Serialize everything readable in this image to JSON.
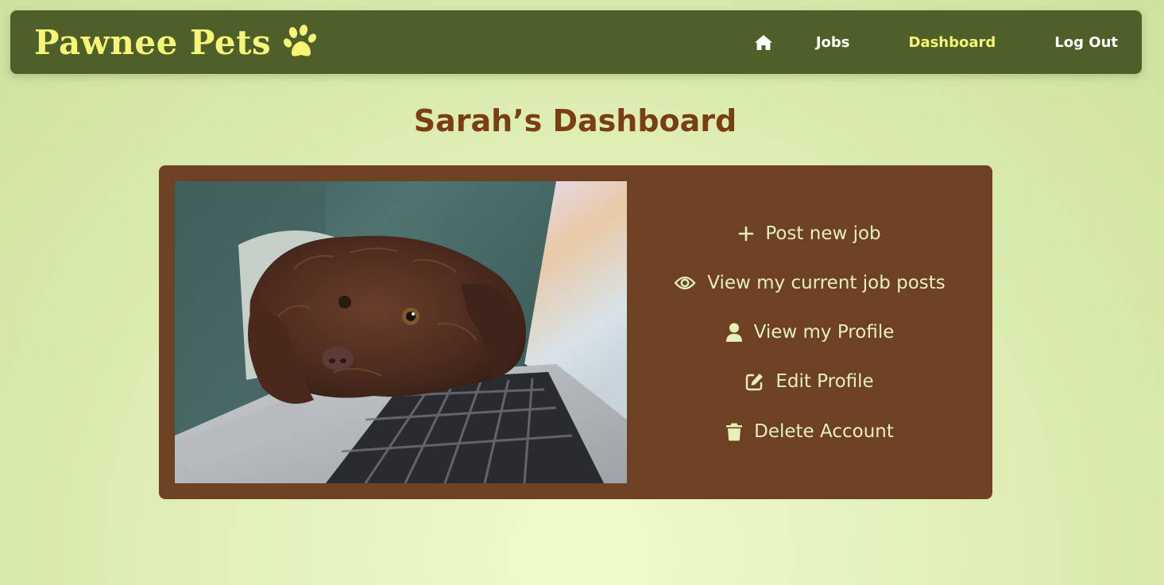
{
  "nav": {
    "brand": "Pawnee Pets",
    "brand_icon": "paw-icon",
    "links": {
      "home_icon": "home-icon",
      "jobs": "Jobs",
      "dashboard": "Dashboard",
      "logout": "Log Out"
    },
    "active": "dashboard",
    "colors": {
      "bar": "#4f5f29",
      "brand": "#f6f578",
      "active_link": "#f6f578",
      "link": "#ffffff"
    }
  },
  "main": {
    "title": "Sarah’s Dashboard",
    "image_icon": "dog-on-laptop-photo",
    "actions": [
      {
        "icon": "plus-icon",
        "label": "Post new job"
      },
      {
        "icon": "eye-icon",
        "label": "View my current job posts"
      },
      {
        "icon": "user-icon",
        "label": "View my Profile"
      },
      {
        "icon": "edit-icon",
        "label": "Edit Profile"
      },
      {
        "icon": "trash-icon",
        "label": "Delete Account"
      }
    ],
    "colors": {
      "title": "#7b3d12",
      "card": "#6f4124",
      "action_text": "#e6f0b6"
    }
  }
}
